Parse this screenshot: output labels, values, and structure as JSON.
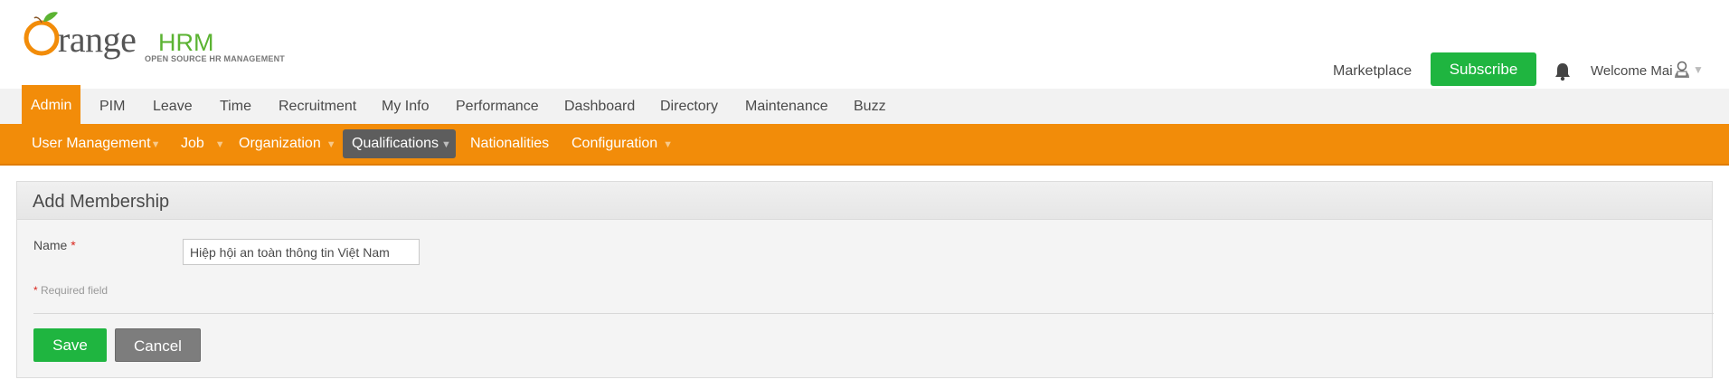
{
  "brand": {
    "logo_text_main": "range",
    "logo_text_hrm": "HRM",
    "logo_tagline": "OPEN SOURCE HR MANAGEMENT"
  },
  "header": {
    "marketplace_label": "Marketplace",
    "subscribe_label": "Subscribe",
    "welcome_label": "Welcome Mai",
    "caret": "▼"
  },
  "main_nav": {
    "items": [
      {
        "label": "Admin",
        "active": true
      },
      {
        "label": "PIM"
      },
      {
        "label": "Leave"
      },
      {
        "label": "Time"
      },
      {
        "label": "Recruitment"
      },
      {
        "label": "My Info"
      },
      {
        "label": "Performance"
      },
      {
        "label": "Dashboard"
      },
      {
        "label": "Directory"
      },
      {
        "label": "Maintenance"
      },
      {
        "label": "Buzz"
      }
    ]
  },
  "sub_nav": {
    "caret": "▼",
    "items": [
      {
        "label": "User Management",
        "dropdown": true
      },
      {
        "label": "Job",
        "dropdown": true
      },
      {
        "label": "Organization",
        "dropdown": true
      },
      {
        "label": "Qualifications",
        "dropdown": true,
        "active": true
      },
      {
        "label": "Nationalities",
        "dropdown": false
      },
      {
        "label": "Configuration",
        "dropdown": true
      }
    ]
  },
  "form": {
    "title": "Add Membership",
    "name_label": "Name",
    "required_star": "*",
    "name_value": "Hiệp hội an toàn thông tin Việt Nam",
    "required_note": "Required field",
    "save_label": "Save",
    "cancel_label": "Cancel"
  },
  "colors": {
    "brand_orange": "#f28c09",
    "brand_green": "#1fb540",
    "active_sub": "#5d5d5d"
  },
  "icons": {
    "bell": "bell-icon",
    "user": "user-icon"
  }
}
